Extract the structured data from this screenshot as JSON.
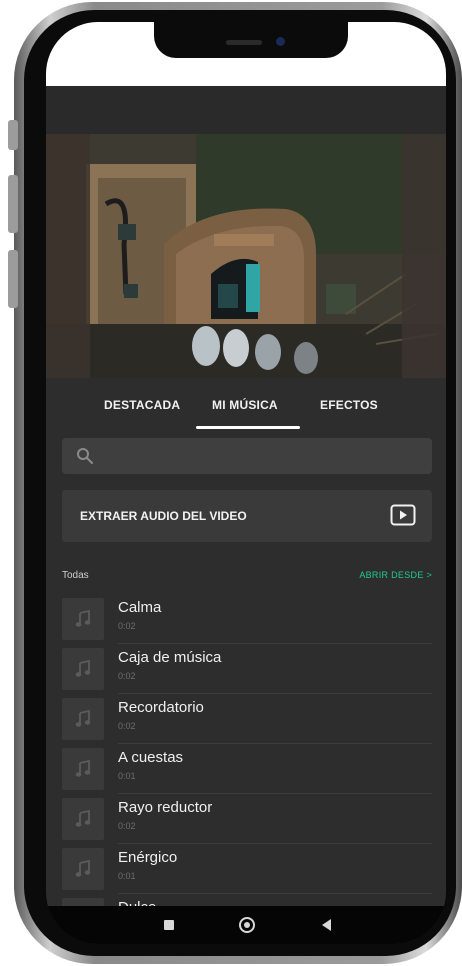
{
  "tabs": [
    {
      "label": "DESTACADA",
      "active": false
    },
    {
      "label": "MI MÚSICA",
      "active": true
    },
    {
      "label": "EFECTOS",
      "active": false
    }
  ],
  "search": {
    "placeholder": "",
    "value": ""
  },
  "extract": {
    "label": "EXTRAER AUDIO DEL VIDEO",
    "icon": "video-play-icon"
  },
  "list_header": {
    "filter_label": "Todas",
    "open_from_label": "ABRIR DESDE >"
  },
  "tracks": [
    {
      "title": "Calma",
      "duration": "0:02"
    },
    {
      "title": "Caja de música",
      "duration": "0:02"
    },
    {
      "title": "Recordatorio",
      "duration": "0:02"
    },
    {
      "title": "A cuestas",
      "duration": "0:01"
    },
    {
      "title": "Rayo reductor",
      "duration": "0:02"
    },
    {
      "title": "Enérgico",
      "duration": "0:01"
    },
    {
      "title": "Dulce",
      "duration": ""
    }
  ],
  "colors": {
    "accent": "#1fcc92",
    "background": "#2d2d2d",
    "card": "#3a3a3a"
  },
  "navigation": {
    "recents": "square-icon",
    "home": "circle-icon",
    "back": "triangle-back-icon"
  }
}
